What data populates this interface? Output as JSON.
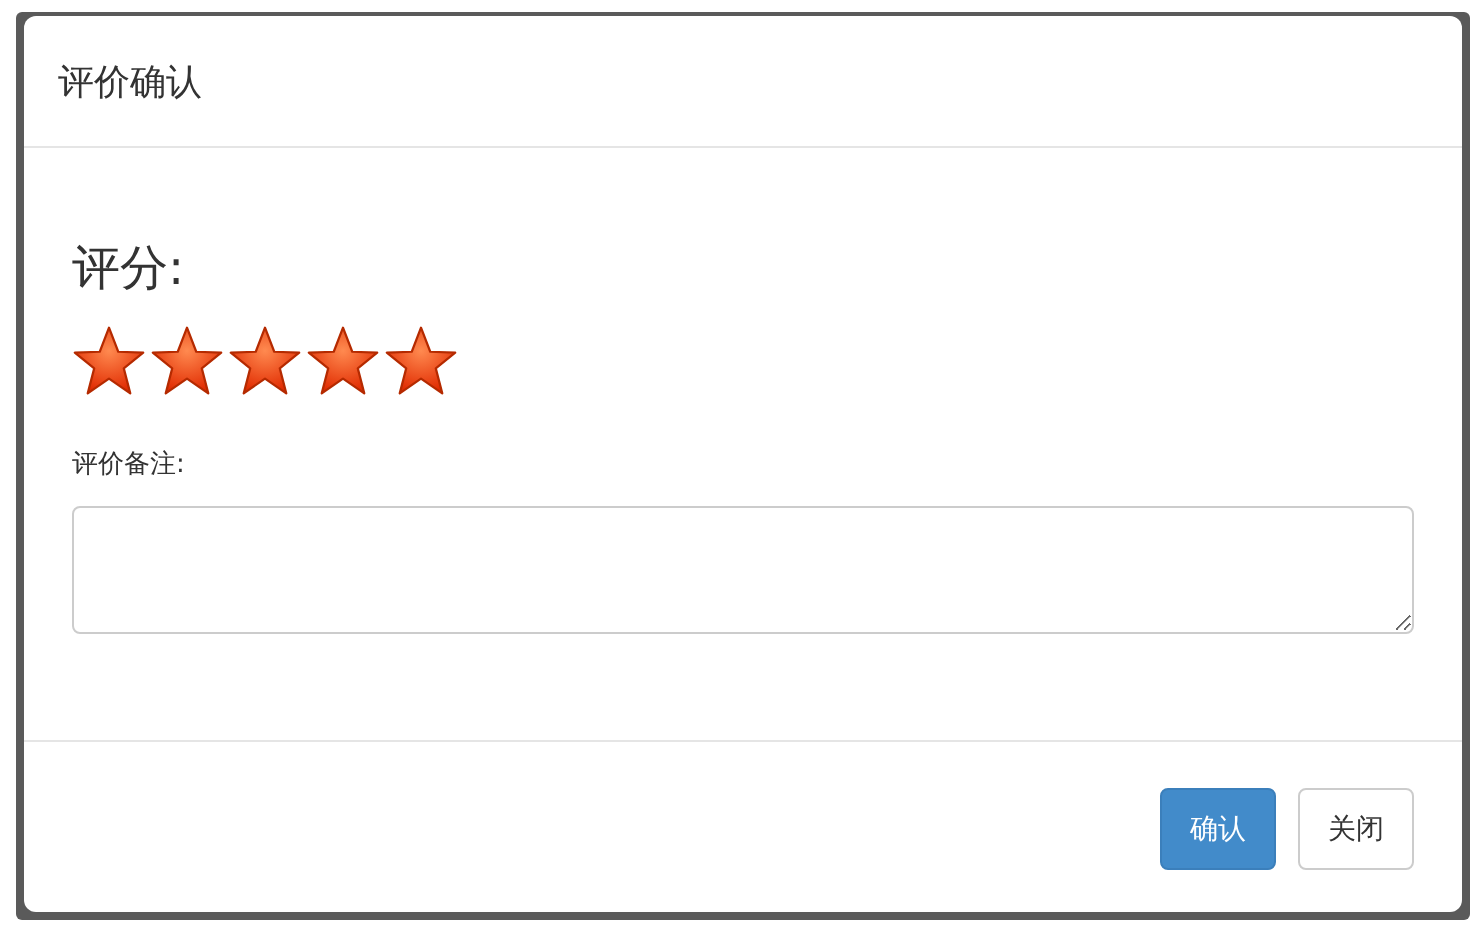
{
  "dialog": {
    "title": "评价确认",
    "rating_label": "评分:",
    "rating": {
      "stars": 5
    },
    "note": {
      "label": "评价备注:"
    },
    "buttons": [
      {
        "label": "确认",
        "kind": "primary"
      },
      {
        "label": "关闭",
        "kind": "default"
      }
    ]
  }
}
